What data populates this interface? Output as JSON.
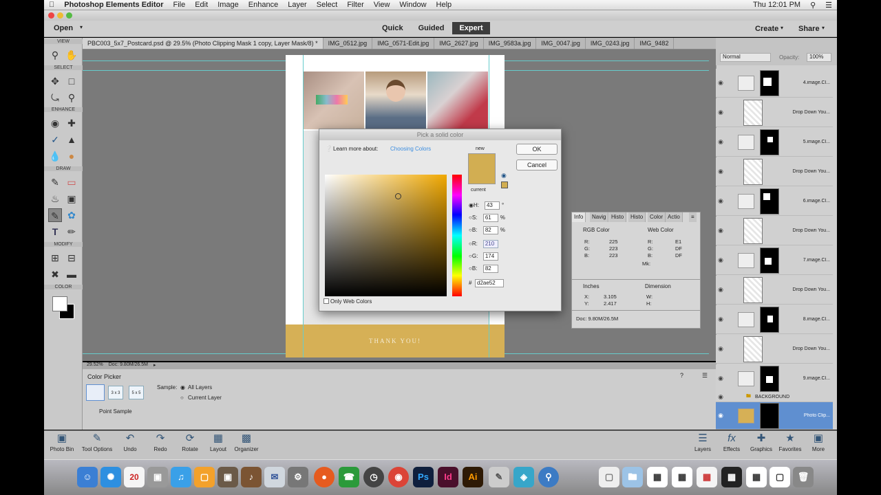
{
  "menubar": {
    "app": "Photoshop Elements Editor",
    "items": [
      "File",
      "Edit",
      "Image",
      "Enhance",
      "Layer",
      "Select",
      "Filter",
      "View",
      "Window",
      "Help"
    ],
    "clock": "Thu 12:01 PM"
  },
  "topbar": {
    "open_label": "Open",
    "modes": [
      "Quick",
      "Guided",
      "Expert"
    ],
    "active_mode": "Expert",
    "create_label": "Create",
    "share_label": "Share"
  },
  "tabs": [
    "PBC003_5x7_Postcard.psd @ 29.5% (Photo Clipping Mask 1 copy, Layer Mask/8) *",
    "IMG_0512.jpg",
    "IMG_0571-Edit.jpg",
    "IMG_2627.jpg",
    "IMG_9583a.jpg",
    "IMG_0047.jpg",
    "IMG_0243.jpg",
    "IMG_9482"
  ],
  "toolbox": {
    "sections": [
      "VIEW",
      "SELECT",
      "ENHANCE",
      "DRAW",
      "MODIFY",
      "COLOR"
    ]
  },
  "canvas": {
    "footer_text": "THANK YOU!"
  },
  "dialog": {
    "title": "Pick a solid color",
    "learn_prefix": "Learn more about:",
    "learn_link": "Choosing Colors",
    "new_label": "new",
    "current_label": "current",
    "ok_label": "OK",
    "cancel_label": "Cancel",
    "fields": [
      {
        "label": "H:",
        "value": "43",
        "unit": "°"
      },
      {
        "label": "S:",
        "value": "61",
        "unit": "%"
      },
      {
        "label": "B:",
        "value": "82",
        "unit": "%"
      },
      {
        "label": "R:",
        "value": "210",
        "unit": ""
      },
      {
        "label": "G:",
        "value": "174",
        "unit": ""
      },
      {
        "label": "B:",
        "value": "82",
        "unit": ""
      }
    ],
    "hex_label": "#",
    "hex_value": "d2ae52",
    "only_web_label": "Only Web Colors",
    "new_color": "#d2ae52",
    "current_color": "#d2ae52"
  },
  "infopanel": {
    "tabs": [
      "Info",
      "Navig",
      "Histo",
      "Histo",
      "Color",
      "Actio"
    ],
    "rgb_label": "RGB Color",
    "web_label": "Web Color",
    "r": "225",
    "g": "223",
    "b": "223",
    "hex_r": "E1",
    "hex_g": "DF",
    "hex_b": "DF",
    "mk_label": "Mk:",
    "units_label": "Inches",
    "dimension_label": "Dimension",
    "x": "3.105",
    "y": "2.417",
    "w_label": "W:",
    "h_label": "H:",
    "doc": "Doc: 9.80M/26.5M"
  },
  "layers_panel": {
    "blend_mode": "Normal",
    "opacity_label": "Opacity:",
    "opacity_value": "100%",
    "layers": [
      {
        "name": "4.image.Cl...",
        "kind": "mask"
      },
      {
        "name": "Drop Down You...",
        "kind": "text"
      },
      {
        "name": "5.image.Cl...",
        "kind": "mask"
      },
      {
        "name": "Drop Down You...",
        "kind": "text"
      },
      {
        "name": "6.image.Cl...",
        "kind": "mask"
      },
      {
        "name": "Drop Down You...",
        "kind": "text"
      },
      {
        "name": "7.image.Cl...",
        "kind": "mask"
      },
      {
        "name": "Drop Down You...",
        "kind": "text"
      },
      {
        "name": "8.image.Cl...",
        "kind": "mask"
      },
      {
        "name": "Drop Down You...",
        "kind": "text"
      },
      {
        "name": "9.image.Cl...",
        "kind": "mask"
      }
    ],
    "background_label": "BACKGROUND",
    "selected_layer": "Photo Clip..."
  },
  "status": {
    "zoom": "29.52%",
    "doc": "Doc: 9.80M/26.5M"
  },
  "tool_options": {
    "title": "Color Picker",
    "point_sample": "Point Sample",
    "sample_label": "Sample:",
    "all_layers": "All Layers",
    "current_layer": "Current Layer",
    "sizes": [
      "",
      "3 x 3",
      "5 x 5"
    ]
  },
  "taskbar": {
    "left": [
      "Photo Bin",
      "Tool Options",
      "Undo",
      "Redo",
      "Rotate",
      "Layout",
      "Organizer"
    ],
    "right": [
      "Layers",
      "Effects",
      "Graphics",
      "Favorites",
      "More"
    ]
  },
  "dock": {
    "items": [
      "Finder",
      "Safari",
      "Calendar",
      "Photos",
      "Music",
      "Terminal",
      "Preview",
      "Mail",
      "Chrome",
      "Firefox",
      "Ps",
      "Id",
      "Ai",
      "Settings",
      "Trash"
    ],
    "calendar_day": "20"
  }
}
